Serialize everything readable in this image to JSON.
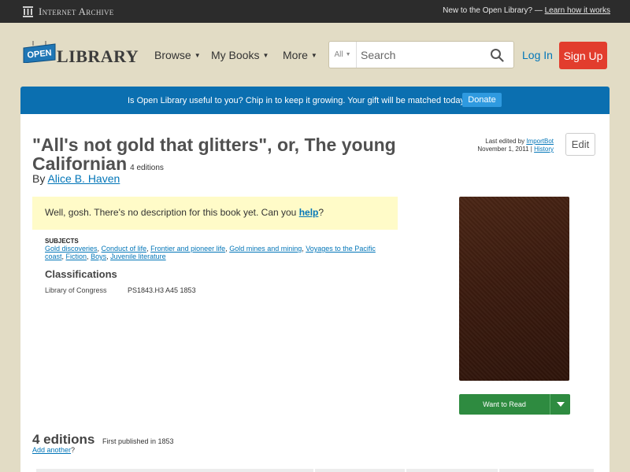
{
  "ia_bar": {
    "logo_text": "Internet Archive",
    "new_text": "New to the Open Library? —",
    "learn_link": "Learn how it works"
  },
  "header": {
    "logo_open": "OPEN",
    "logo_library": "LIBRARY",
    "nav": [
      "Browse",
      "My Books",
      "More"
    ],
    "search_scope": "All",
    "search_placeholder": "Search",
    "login": "Log In",
    "signup": "Sign Up"
  },
  "banner": {
    "text": "Is Open Library useful to you? Chip in to keep it growing. Your gift will be matched today!",
    "donate": "Donate"
  },
  "book": {
    "title": "\"All's not gold that glitters\", or, The young Californian",
    "editions_count": "4 editions",
    "by": "By",
    "author": "Alice B. Haven",
    "last_edited_label": "Last edited by",
    "last_edited_user": "ImportBot",
    "last_edited_date": "November 1, 2011 |",
    "history": "History",
    "edit": "Edit",
    "desc_prefix": "Well, gosh. There's no description for this book yet. Can you",
    "desc_help": "help",
    "desc_suffix": "?",
    "subjects_heading": "SUBJECTS",
    "subjects": [
      "Gold discoveries",
      "Conduct of life",
      "Frontier and pioneer life",
      "Gold mines and mining",
      "Voyages to the Pacific coast",
      "Fiction",
      "Boys",
      "Juvenile literature"
    ],
    "classifications_heading": "Classifications",
    "classification_key": "Library of Congress",
    "classification_value": "PS1843.H3 A45 1853",
    "want_to_read": "Want to Read"
  },
  "editions": {
    "heading": "4 editions",
    "first_published": "First published in 1853",
    "add_another": "Add another",
    "add_suffix": "?"
  },
  "colors": {
    "background": "#e2dcc5",
    "banner": "#0b6fb0",
    "signup": "#e23d2d",
    "want_to_read": "#2e8b40",
    "link": "#0376b8"
  }
}
